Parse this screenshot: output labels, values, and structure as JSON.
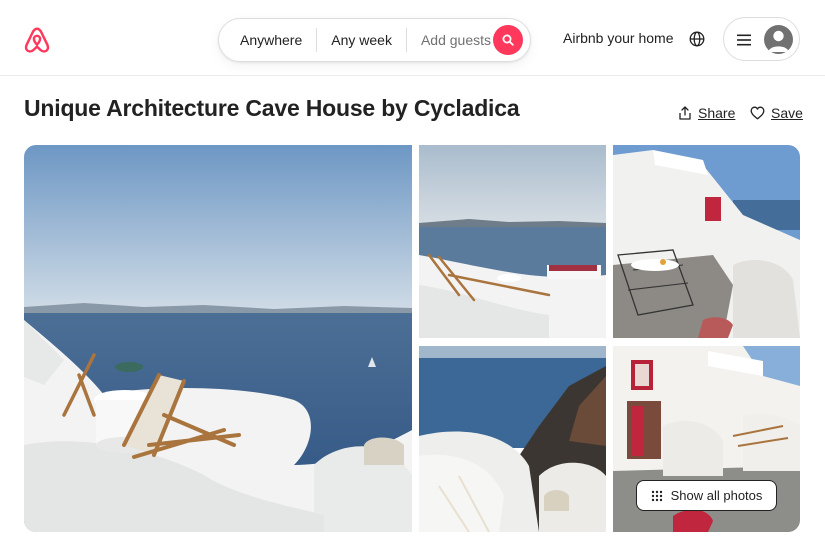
{
  "header": {
    "search": {
      "location": "Anywhere",
      "dates": "Any week",
      "guests": "Add guests"
    },
    "host_link": "Airbnb your home",
    "icons": [
      "airbnb-logo-icon",
      "search-icon",
      "globe-icon",
      "menu-icon",
      "user-avatar-icon"
    ]
  },
  "listing": {
    "title": "Unique Architecture Cave House by Cycladica",
    "share_label": "Share",
    "save_label": "Save"
  },
  "gallery": {
    "show_all_label": "Show all photos"
  },
  "colors": {
    "brand": "#ff385c",
    "text": "#222222",
    "muted": "#717171",
    "border": "#dddddd"
  }
}
